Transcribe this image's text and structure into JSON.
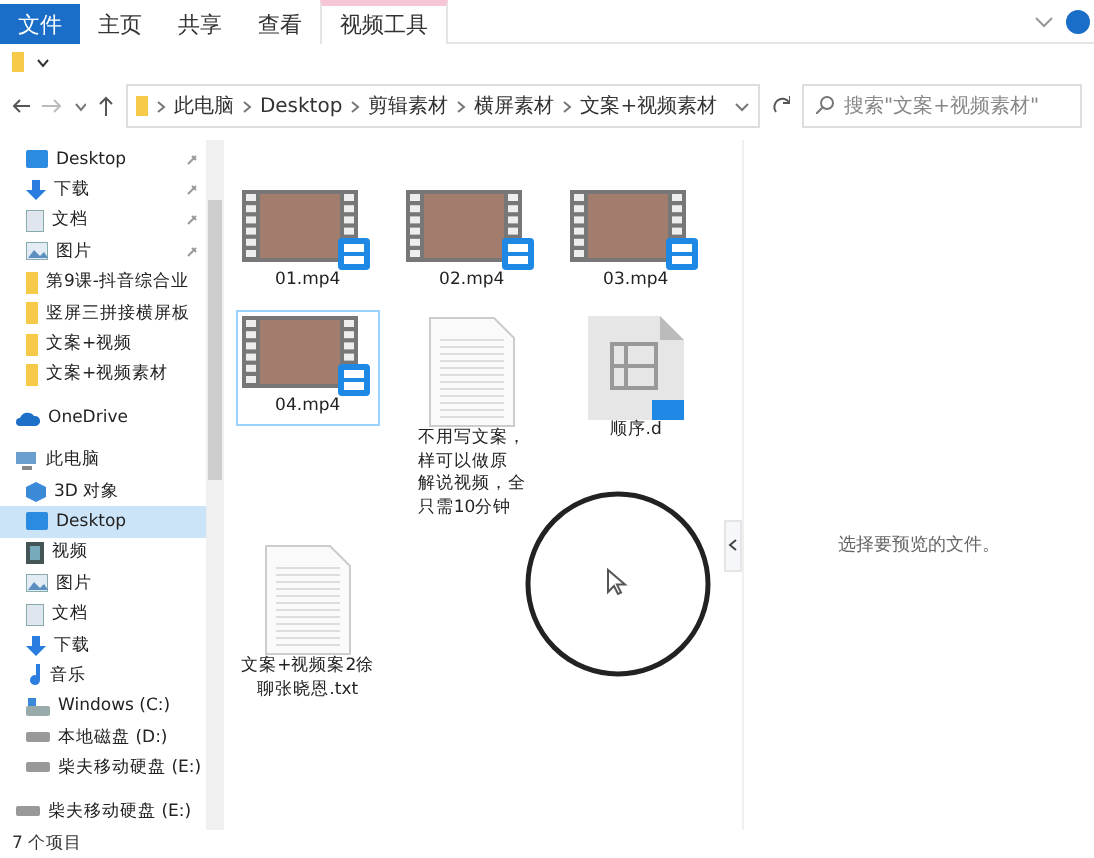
{
  "ribbon": {
    "file_button": "文件",
    "tabs": [
      {
        "label": "主页",
        "kind": "normal"
      },
      {
        "label": "共享",
        "kind": "normal"
      },
      {
        "label": "查看",
        "kind": "normal"
      },
      {
        "label": "视频工具",
        "kind": "contextual"
      }
    ]
  },
  "address": {
    "path": [
      "此电脑",
      "Desktop",
      "剪辑素材",
      "横屏素材",
      "文案+视频素材"
    ]
  },
  "search": {
    "placeholder": "搜索\"文案+视频素材\""
  },
  "sidebar": {
    "items": [
      {
        "label": "Desktop",
        "kind": "desktop",
        "pinned": true,
        "selected": false
      },
      {
        "label": "下载",
        "kind": "download",
        "pinned": true,
        "selected": false
      },
      {
        "label": "文档",
        "kind": "document",
        "pinned": true,
        "selected": false
      },
      {
        "label": "图片",
        "kind": "picture",
        "pinned": true,
        "selected": false
      },
      {
        "label": "第9课-抖音综合业",
        "kind": "folder",
        "pinned": false,
        "selected": false
      },
      {
        "label": "竖屏三拼接横屏板",
        "kind": "folder",
        "pinned": false,
        "selected": false
      },
      {
        "label": "文案+视频",
        "kind": "folder",
        "pinned": false,
        "selected": false
      },
      {
        "label": "文案+视频素材",
        "kind": "folder",
        "pinned": false,
        "selected": false
      },
      {
        "label": "OneDrive",
        "kind": "cloud",
        "pinned": false,
        "selected": false
      },
      {
        "label": "此电脑",
        "kind": "pc",
        "pinned": false,
        "selected": false
      },
      {
        "label": "3D 对象",
        "kind": "cube",
        "pinned": false,
        "selected": false
      },
      {
        "label": "Desktop",
        "kind": "desktop",
        "pinned": false,
        "selected": true
      },
      {
        "label": "视频",
        "kind": "video",
        "pinned": false,
        "selected": false
      },
      {
        "label": "图片",
        "kind": "picture",
        "pinned": false,
        "selected": false
      },
      {
        "label": "文档",
        "kind": "document",
        "pinned": false,
        "selected": false
      },
      {
        "label": "下载",
        "kind": "download",
        "pinned": false,
        "selected": false
      },
      {
        "label": "音乐",
        "kind": "music",
        "pinned": false,
        "selected": false
      },
      {
        "label": "Windows (C:)",
        "kind": "windrive",
        "pinned": false,
        "selected": false
      },
      {
        "label": "本地磁盘 (D:)",
        "kind": "drive",
        "pinned": false,
        "selected": false
      },
      {
        "label": "柴夫移动硬盘 (E:)",
        "kind": "drive",
        "pinned": false,
        "selected": false
      },
      {
        "label": "柴夫移动硬盘 (E:)",
        "kind": "drive",
        "pinned": false,
        "selected": false
      }
    ]
  },
  "files": [
    {
      "name": [
        "01.mp4"
      ],
      "kind": "video",
      "selected": false
    },
    {
      "name": [
        "02.mp4"
      ],
      "kind": "video",
      "selected": false
    },
    {
      "name": [
        "03.mp4"
      ],
      "kind": "video",
      "selected": false
    },
    {
      "name": [
        "04.mp4"
      ],
      "kind": "video",
      "selected": true
    },
    {
      "name": [
        "不用写文案，",
        "样可以做原",
        "解说视频，全",
        "只需10分钟"
      ],
      "kind": "text",
      "selected": false
    },
    {
      "name": [
        "顺序.d"
      ],
      "kind": "media",
      "selected": false
    },
    {
      "name": [
        "文案+视频案2徐",
        "聊张晓恩.txt"
      ],
      "kind": "text",
      "selected": false
    }
  ],
  "preview": {
    "message": "选择要预览的文件。"
  },
  "status_bar": {
    "count": "7 个项目"
  }
}
